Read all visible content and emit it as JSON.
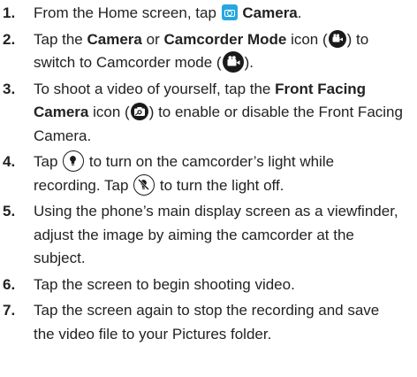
{
  "steps": [
    {
      "num": "1.",
      "t1": "From the Home screen, tap",
      "t2": "Camera",
      "t3": "."
    },
    {
      "num": "2.",
      "t1": "Tap the",
      "t2": "Camera",
      "t3": "or",
      "t4": "Camcorder Mode",
      "t5": "icon (",
      "t6": ") to",
      "t7": "switch to Camcorder mode (",
      "t8": ")."
    },
    {
      "num": "3.",
      "t1": "To shoot a video of yourself, tap the",
      "t2": "Front Facing",
      "t3": "Camera",
      "t4": "icon (",
      "t5": ") to enable or disable the Front Facing",
      "t6": "Camera."
    },
    {
      "num": "4.",
      "t1": "Tap",
      "t2": "to turn on the camcorder’s light while",
      "t3": "recording. Tap",
      "t4": "to turn the light off."
    },
    {
      "num": "5.",
      "t1": "Using the phone’s main display screen as a viewfinder,",
      "t2": "adjust the image by aiming the camcorder at the",
      "t3": "subject."
    },
    {
      "num": "6.",
      "t1": "Tap the screen to begin shooting video."
    },
    {
      "num": "7.",
      "t1": "Tap the screen again to stop the recording and save",
      "t2": "the video file to your Pictures folder."
    }
  ],
  "icons": {
    "camera_app": "camera-app-icon",
    "camcorder_mode": "camcorder-mode-icon",
    "camcorder_on": "camcorder-mode-active-icon",
    "front_camera": "front-facing-camera-icon",
    "light_on": "light-on-icon",
    "light_off": "light-off-icon"
  },
  "colors": {
    "camera_app_bg": "#27a7e0",
    "text": "#222222",
    "icon_dark": "#1a1a1a"
  }
}
